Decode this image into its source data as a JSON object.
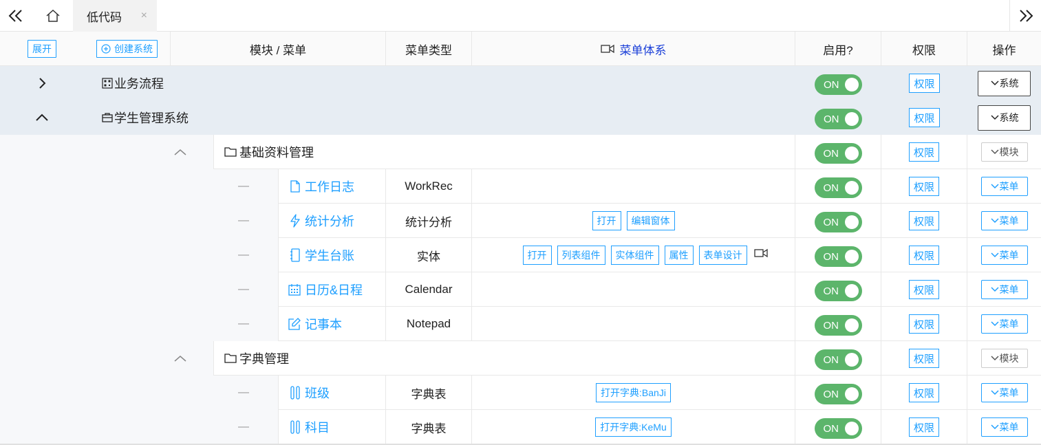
{
  "tabbar": {
    "active_tab": "低代码",
    "close_glyph": "×"
  },
  "header": {
    "expand_label": "展开",
    "create_system_label": "创建系统",
    "col_module_menu": "模块 / 菜单",
    "col_menu_type": "菜单类型",
    "col_menu_system": "菜单体系",
    "col_enabled": "启用?",
    "col_permission": "权限",
    "col_action": "操作"
  },
  "toggle_label": "ON",
  "permission_label": "权限",
  "systems": [
    {
      "name": "业务流程",
      "action": "系统",
      "expanded": false
    },
    {
      "name": "学生管理系统",
      "action": "系统",
      "expanded": true
    }
  ],
  "modules": [
    {
      "name": "基础资料管理",
      "action": "模块"
    },
    {
      "name": "字典管理",
      "action": "模块"
    }
  ],
  "menus": [
    {
      "dash": "—",
      "name": "工作日志",
      "icon": "file-icon",
      "type": "WorkRec",
      "tags": [],
      "action": "菜单"
    },
    {
      "dash": "—",
      "name": "统计分析",
      "icon": "bolt-icon",
      "type": "统计分析",
      "tags": [
        "打开",
        "编辑窗体"
      ],
      "action": "菜单"
    },
    {
      "dash": "—",
      "name": "学生台账",
      "icon": "book-icon",
      "type": "实体",
      "tags": [
        "打开",
        "列表组件",
        "实体组件",
        "属性",
        "表单设计"
      ],
      "action": "菜单"
    },
    {
      "dash": "—",
      "name": "日历&日程",
      "icon": "calendar-icon",
      "type": "Calendar",
      "tags": [],
      "action": "菜单"
    },
    {
      "dash": "—",
      "name": "记事本",
      "icon": "edit-icon",
      "type": "Notepad",
      "tags": [],
      "action": "菜单"
    },
    {
      "dash": "—",
      "name": "班级",
      "icon": "columns-icon",
      "type": "字典表",
      "tags": [
        "打开字典:BanJi"
      ],
      "action": "菜单"
    },
    {
      "dash": "—",
      "name": "科目",
      "icon": "columns-icon",
      "type": "字典表",
      "tags": [
        "打开字典:KeMu"
      ],
      "action": "菜单"
    }
  ],
  "colors": {
    "accent": "#1e9fff",
    "toggle_on": "#5cb56b",
    "system_row_bg": "#e7edf3",
    "header_link": "#1a3fd8"
  }
}
